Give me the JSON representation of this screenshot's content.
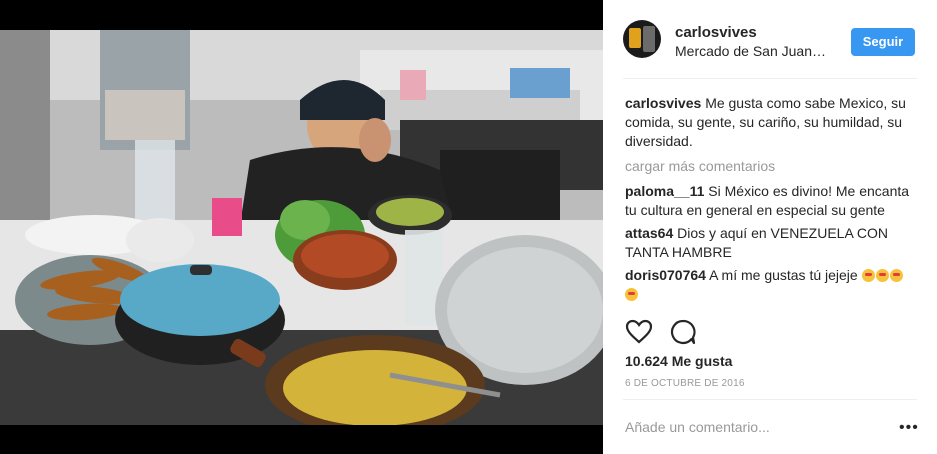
{
  "header": {
    "username": "carlosvives",
    "location": "Mercado de San Juan…",
    "follow_label": "Seguir"
  },
  "caption": {
    "username": "carlosvives",
    "text": "Me gusta como sabe Mexico, su comida, su gente, su cariño, su humildad, su diversidad."
  },
  "load_more": "cargar más comentarios",
  "comments": [
    {
      "username": "paloma__11",
      "text": "Si México es divino! Me encanta tu cultura en general en especial su gente"
    },
    {
      "username": "attas64",
      "text": "Dios y aquí en VENEZUELA CON TANTA HAMBRE"
    },
    {
      "username": "doris070764",
      "text": "A mí me gustas tú jejeje"
    }
  ],
  "icons": [
    "heart-icon",
    "comment-icon",
    "more-options-icon"
  ],
  "likes": "10.624 Me gusta",
  "date": "6 DE OCTUBRE DE 2016",
  "add_comment_placeholder": "Añade un comentario...",
  "more_options": "•••",
  "colors": {
    "follow_button": "#3897f0",
    "muted_text": "#999999"
  }
}
